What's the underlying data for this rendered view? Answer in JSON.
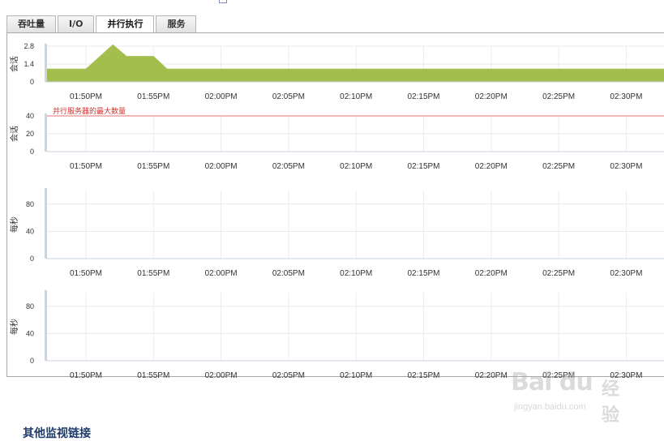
{
  "tabs": [
    {
      "label": "吞吐量",
      "active": false
    },
    {
      "label": "I/O",
      "active": false
    },
    {
      "label": "并行执行",
      "active": true
    },
    {
      "label": "服务",
      "active": false
    }
  ],
  "x_ticks": [
    "01:50PM",
    "01:55PM",
    "02:00PM",
    "02:05PM",
    "02:10PM",
    "02:15PM",
    "02:20PM",
    "02:25PM",
    "02:30PM"
  ],
  "charts": [
    {
      "ylabel": "会话",
      "limit_label": ""
    },
    {
      "ylabel": "会话",
      "limit_label": "并行服务器的最大数量"
    },
    {
      "ylabel": "每秒",
      "limit_label": ""
    },
    {
      "ylabel": "每秒",
      "limit_label": ""
    }
  ],
  "chart_data": [
    {
      "type": "area",
      "ylabel": "会话",
      "yticks": [
        "0",
        "1.4",
        "2.8"
      ],
      "ylim": [
        0,
        2.8
      ],
      "x": [
        "01:48PM",
        "01:50PM",
        "01:52PM",
        "01:53PM",
        "01:55PM",
        "01:56PM",
        "02:33PM"
      ],
      "values": [
        1,
        1,
        2.9,
        2.0,
        2.0,
        1,
        1
      ],
      "color": "#a3be4c",
      "grid": true
    },
    {
      "type": "line",
      "ylabel": "会话",
      "yticks": [
        "0",
        "20",
        "40"
      ],
      "ylim": [
        0,
        40
      ],
      "series": [
        {
          "name": "并行服务器的最大数量",
          "values": [
            40,
            40
          ],
          "color": "#e07070"
        }
      ],
      "grid": true
    },
    {
      "type": "line",
      "ylabel": "每秒",
      "yticks": [
        "0",
        "40",
        "80"
      ],
      "ylim": [
        0,
        100
      ],
      "series": [],
      "grid": true
    },
    {
      "type": "line",
      "ylabel": "每秒",
      "yticks": [
        "0",
        "40",
        "80"
      ],
      "ylim": [
        0,
        100
      ],
      "series": [],
      "grid": true
    }
  ],
  "watermark": {
    "brand": "Bai du",
    "cn": "经验",
    "url": "jingyan.baidu.com"
  },
  "footer_link": "其他监视链接"
}
